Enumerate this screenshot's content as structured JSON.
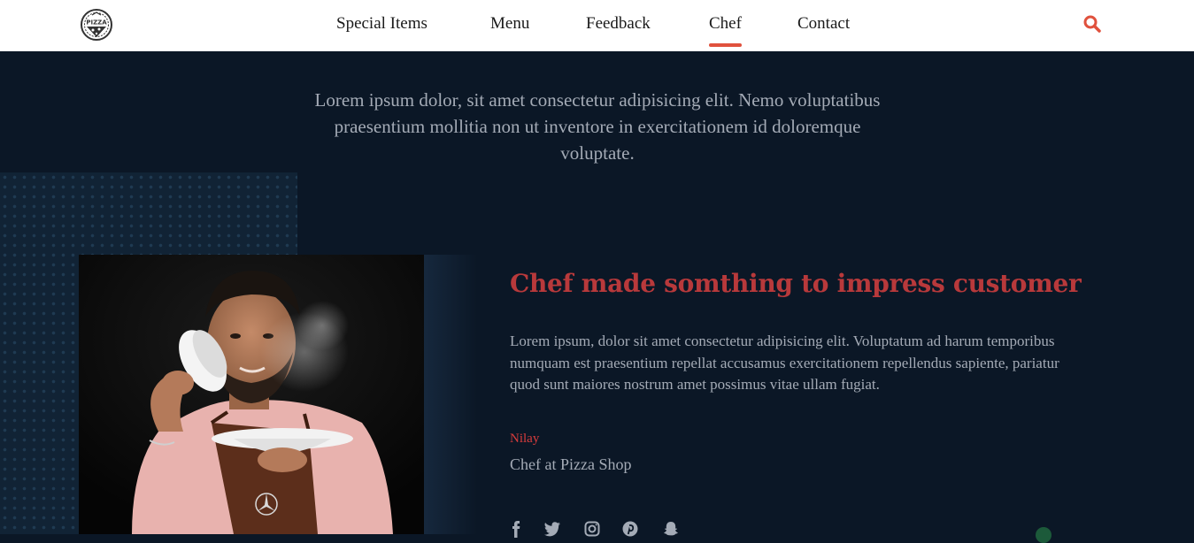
{
  "header": {
    "logo_text": "PIZZA",
    "nav": [
      {
        "label": "Special Items",
        "active": false
      },
      {
        "label": "Menu",
        "active": false
      },
      {
        "label": "Feedback",
        "active": false
      },
      {
        "label": "Chef",
        "active": true
      },
      {
        "label": "Contact",
        "active": false
      }
    ],
    "search_icon": "search-icon",
    "accent_color": "#e0513d"
  },
  "intro": {
    "text": "Lorem ipsum dolor, sit amet consectetur adipisicing elit. Nemo voluptatibus praesentium mollitia non ut inventore in exercitationem id doloremque voluptate."
  },
  "chef": {
    "heading": "Chef made somthing to impress customer",
    "description": "Lorem ipsum, dolor sit amet consectetur adipisicing elit. Voluptatum ad harum temporibus numquam est praesentium repellat accusamus exercitationem repellendus sapiente, pariatur quod sunt maiores nostrum amet possimus vitae ullam fugiat.",
    "name": "Nilay",
    "role": "Chef at Pizza Shop",
    "heading_color": "#b8393b",
    "name_color": "#d83c3c",
    "social": [
      "facebook-icon",
      "twitter-icon",
      "instagram-icon",
      "pinterest-icon",
      "snapchat-icon"
    ]
  },
  "colors": {
    "background": "#0b1726",
    "text_muted": "#a4abb6"
  }
}
